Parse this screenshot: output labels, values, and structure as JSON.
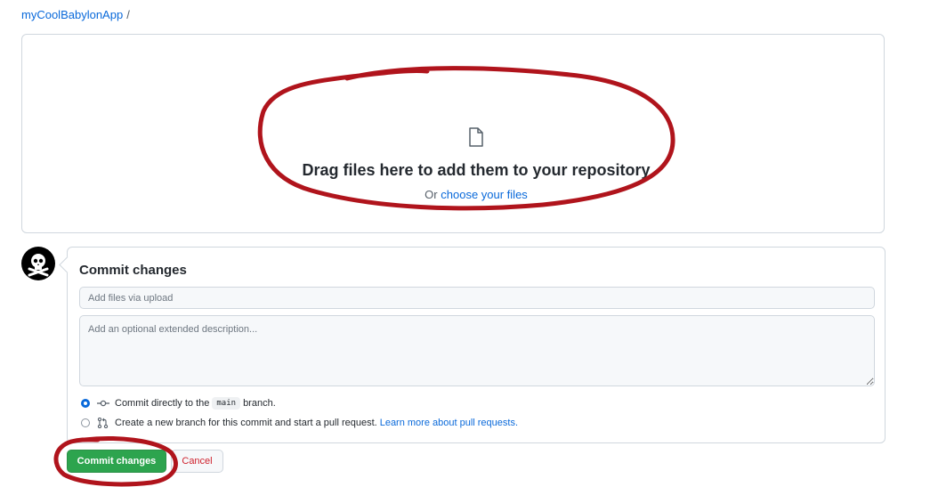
{
  "breadcrumb": {
    "repo": "myCoolBabylonApp",
    "separator": "/"
  },
  "dropzone": {
    "icon": "file-icon",
    "title": "Drag files here to add them to your repository",
    "or_text": "Or",
    "choose_link": "choose your files"
  },
  "commit": {
    "heading": "Commit changes",
    "summary_placeholder": "Add files via upload",
    "description_placeholder": "Add an optional extended description...",
    "option_direct": {
      "prefix": "Commit directly to the",
      "branch": "main",
      "suffix": "branch.",
      "selected": true
    },
    "option_new_branch": {
      "text": "Create a new branch for this commit and start a pull request.",
      "link": "Learn more about pull requests.",
      "selected": false
    },
    "commit_button": "Commit changes",
    "cancel_button": "Cancel"
  },
  "colors": {
    "link": "#0969da",
    "primary_button": "#2da44e",
    "cancel_text": "#cf222e",
    "annotation": "#b0141c"
  }
}
